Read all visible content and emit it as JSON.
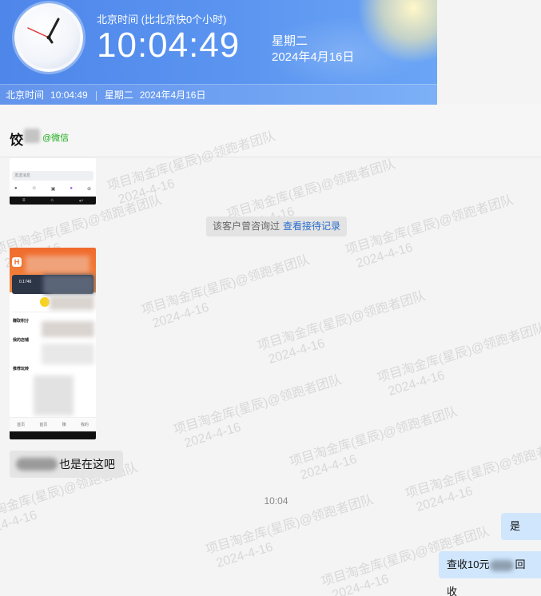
{
  "clock": {
    "title": "北京时间 (比北京快0个小时)",
    "time": "10:04:49",
    "weekday": "星期二",
    "date": "2024年4月16日"
  },
  "strip": {
    "label": "北京时间",
    "time": "10:04:49",
    "weekday": "星期二",
    "date": "2024年4月16日"
  },
  "chat": {
    "contact_name_visible": "饺",
    "source": "@微信",
    "notice_text": "该客户曾咨询过",
    "notice_link": "查看接待记录",
    "left_message_tail": "也是在这吧",
    "timestamp": "10:04",
    "right_message_1": "是",
    "right_message_2_prefix": "查收10元",
    "right_message_2_suffix": "回收"
  },
  "thumbnail": {
    "phone_balance": "0.1746",
    "section_1": "赚取积分",
    "section_2": "我的店铺",
    "section_3": "推荐玩转",
    "logo": "H",
    "tabs": [
      "首页",
      "首页",
      "赚",
      "我的"
    ]
  },
  "watermark": {
    "text": "项目淘金库(星辰)@领跑者团队",
    "date": "2024-4-16"
  },
  "colors": {
    "banner": "#4e86ea",
    "bubble_right": "#cfe6fc",
    "link": "#2a6ccb",
    "source": "#1aad19"
  }
}
